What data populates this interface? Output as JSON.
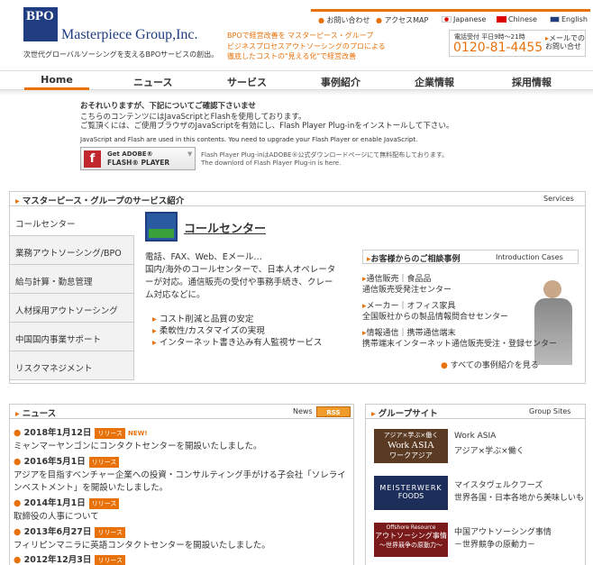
{
  "header": {
    "logo_mark": "BPO",
    "company_name": "Masterpiece Group,Inc.",
    "tagline": "次世代グローバルソーシングを支えるBPOサービスの創出。",
    "catch_prefix": "BPOで経営改善を",
    "catch_highlight": "マスターピース・グループ",
    "catch_line2": "ビジネスプロセスアウトソーシングのプロによる",
    "catch_line3": "徹底したコストの\"見える化\"で経営改善",
    "links": {
      "contact": "お問い合わせ",
      "access": "アクセスMAP",
      "japanese": "Japanese",
      "chinese": "Chinese",
      "english": "English"
    },
    "tel_label": "電話受付 平日9時～21時",
    "tel_number": "0120-81-4455",
    "mail_label": "メールでのお問い合せ"
  },
  "nav": {
    "items": [
      "Home",
      "ニュース",
      "サービス",
      "事例紹介",
      "企業情報",
      "採用情報"
    ]
  },
  "notice": {
    "line1": "おそれいりますが、下記についてご確認下さいませ",
    "line2": "こちらのコンテンツにはJavaScriptとFlashを使用しております。",
    "line3": "ご覧頂くには、ご使用ブラウザのJavaScriptを有効にし、Flash Player Plug-inをインストールして下さい。",
    "line4": "JavaScript and Flash are used in this contents. You need to upgrade your Flash Player or enable JavaScript.",
    "flash_get": "Get ADOBE®",
    "flash_player": "FLASH® PLAYER",
    "flash_note1": "Flash Player Plug-inはADOBE®公式ダウンロードページにて無料配布しております。",
    "flash_note2": "The downlord of Flash Player Plug-in is here."
  },
  "services": {
    "title": "マスターピース・グループのサービス紹介",
    "sub": "Services",
    "tabs": [
      "コールセンター",
      "業務アウトソーシング/BPO",
      "給与計算・勤怠管理",
      "人材採用アウトソーシング",
      "中国国内事業サポート",
      "リスクマネジメント"
    ],
    "panel_title": "コールセンター",
    "desc": [
      "電話、FAX、Web、Eメール…",
      "国内/海外のコールセンターで、日本人オペレータ",
      "ーが対応。通信販売の受付や事務手続き、クレー",
      "ム対応などに。"
    ],
    "bullets": [
      "コスト削減と品質の安定",
      "柔軟性/カスタマイズの実現",
      "インターネット書き込み有人監視サービス"
    ],
    "examples_title": "お客様からのご相談事例",
    "examples_sub": "Introduction Cases",
    "examples": [
      {
        "head": "通信販売｜食品品",
        "body": "通信販売受発注センター"
      },
      {
        "head": "メーカー｜オフィス家具",
        "body": "全国販社からの製品情報問合せセンター"
      },
      {
        "head": "情報通信｜携帯通信端末",
        "body": "携帯端末インターネット通信販売受注・登録センター"
      }
    ],
    "examples_more": "すべての事例紹介を見る"
  },
  "news": {
    "title": "ニュース",
    "sub": "News",
    "rss": "RSS",
    "badge": "リリース",
    "new_tag": "NEW!",
    "items": [
      {
        "date": "2018年1月12日",
        "text": [
          "ミャンマーヤンゴンにコンタクトセンターを開設いたしました。"
        ]
      },
      {
        "date": "2016年5月1日",
        "text": [
          "アジアを目指すベンチャー企業への投資・コンサルティング手がける子会社「ソレライ",
          "ンベストメント」を開設いたしました。"
        ]
      },
      {
        "date": "2014年1月1日",
        "text": [
          "取締役の人事について"
        ]
      },
      {
        "date": "2013年6月27日",
        "text": [
          "フィリピンマニラに英語コンタクトセンターを開設いたしました。"
        ]
      },
      {
        "date": "2012年12月3日",
        "text": []
      }
    ]
  },
  "group": {
    "title": "グループサイト",
    "sub": "Group Sites",
    "sites": [
      {
        "img_top": "アジア×学ぶ×働く",
        "img_mid": "Work ASIA",
        "img_bot": "ワークアジア",
        "name": "Work ASIA",
        "desc": "アジア×学ぶ×働く"
      },
      {
        "img_top": "MEISTERWERK",
        "img_mid": "FOODS",
        "img_bot": "",
        "name": "マイスタヴェルクフーズ",
        "desc": "世界各国・日本各地から美味しいも"
      },
      {
        "img_top": "Offshore Resource",
        "img_mid": "アウトソーシング事情",
        "img_bot": "～世界競争の原動力～",
        "name": "中国アウトソーシング事情",
        "desc": "－世界競争の原動力－"
      }
    ]
  },
  "colors": {
    "accent": "#e8710a",
    "brand": "#1f3d80"
  }
}
